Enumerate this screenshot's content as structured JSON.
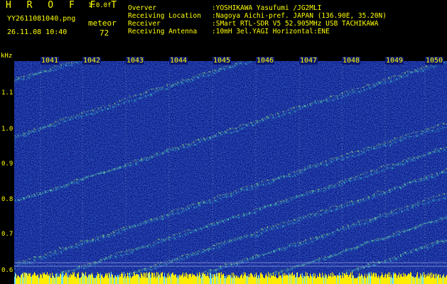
{
  "header": {
    "brand": "H R O F F T",
    "version": "1.0.0f",
    "filename": "YY2611081040.png",
    "meteor_label": "meteor",
    "datetime": "26.11.08 10:40",
    "meteor_count": "72"
  },
  "info": [
    {
      "key": "Overver",
      "value": ":YOSHIKAWA Yasufumi /JG2MLI"
    },
    {
      "key": "Receiving Location",
      "value": ":Nagoya Aichi-pref. JAPAN (136.90E, 35.20N)"
    },
    {
      "key": "Receiver",
      "value": ":SMart RTL-SDR V5 52.905MHz USB TACHIKAWA"
    },
    {
      "key": "Receiving Antenna",
      "value": ":10mH 3el.YAGI Horizontal:ENE"
    }
  ],
  "axis": {
    "y_unit": "kHz",
    "y_ticks": [
      "1.1",
      "1.0",
      "0.9",
      "0.8",
      "0.7",
      "0.6"
    ],
    "x_ticks": [
      "1041",
      "1042",
      "1043",
      "1044",
      "1045",
      "1046",
      "1047",
      "1048",
      "1049",
      "1050"
    ]
  },
  "colors": {
    "text": "#ffff00",
    "background": "#000000",
    "plot_bg": "#0a1a80"
  }
}
